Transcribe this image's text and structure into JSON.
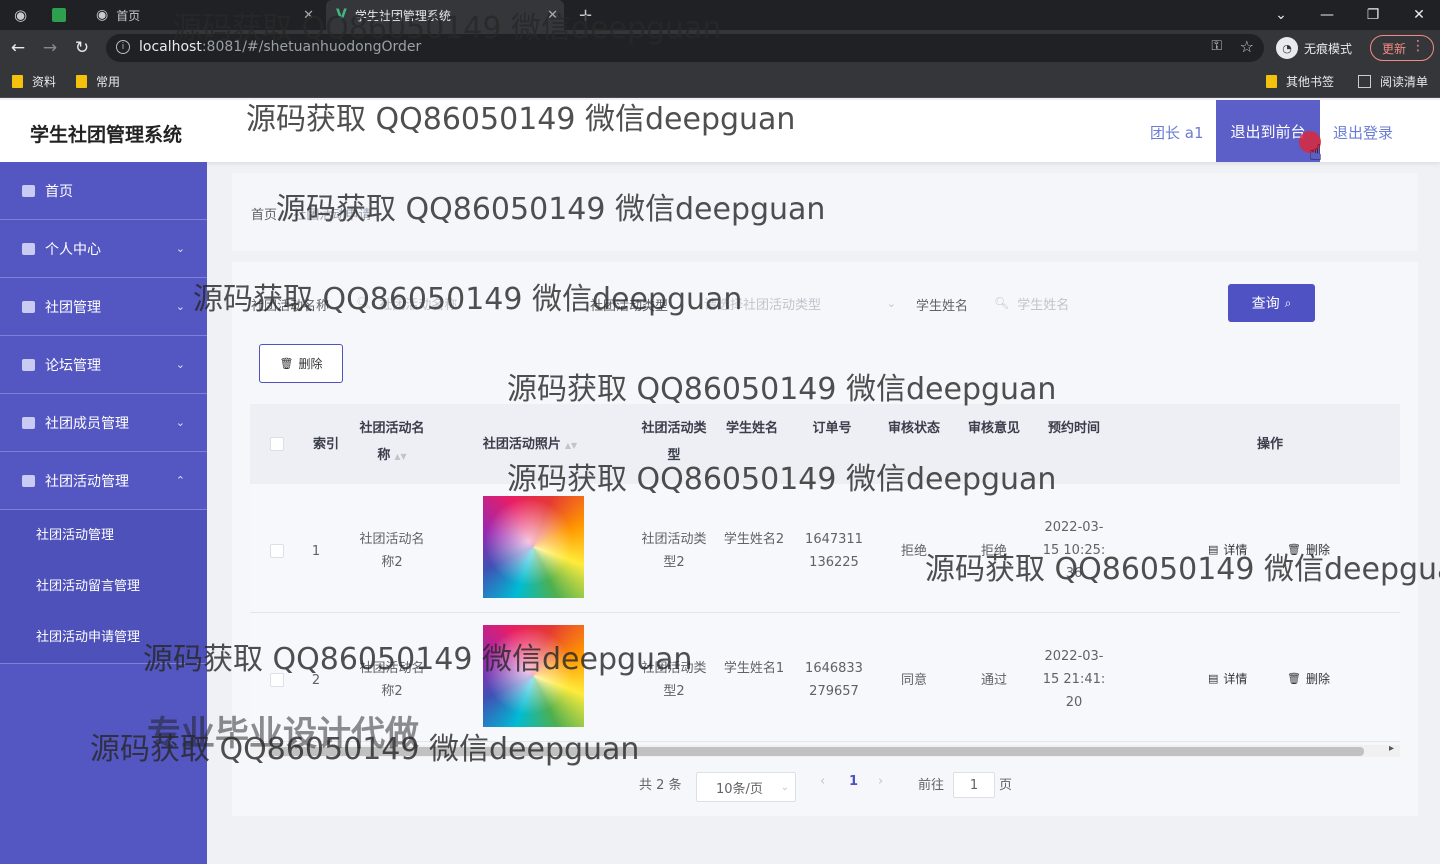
{
  "browser": {
    "tabs": [
      {
        "label": "首页",
        "active": false
      },
      {
        "label": "学生社团管理系统",
        "active": true
      }
    ],
    "new_tab": "+",
    "url_host": "localhost",
    "url_path": ":8081/#/shetuanhuodongOrder",
    "incognito_label": "无痕模式",
    "update_label": "更新",
    "bookmarks": [
      "资料",
      "常用"
    ],
    "bookmarks_right": [
      "其他书签",
      "阅读清单"
    ]
  },
  "header": {
    "title": "学生社团管理系统",
    "user": "团长 a1",
    "back_front": "退出到前台",
    "logout": "退出登录"
  },
  "sidebar": {
    "items": [
      {
        "label": "首页",
        "arrow": ""
      },
      {
        "label": "个人中心",
        "arrow": "⌄"
      },
      {
        "label": "社团管理",
        "arrow": "⌄"
      },
      {
        "label": "论坛管理",
        "arrow": "⌄"
      },
      {
        "label": "社团成员管理",
        "arrow": "⌄"
      },
      {
        "label": "社团活动管理",
        "arrow": "⌃"
      }
    ],
    "subitems": [
      "社团活动管理",
      "社团活动留言管理",
      "社团活动申请管理"
    ]
  },
  "breadcrumb": {
    "home": "首页",
    "sep": "/",
    "current": "社团活动申请"
  },
  "search": {
    "name_label": "社团活动名称",
    "name_placeholder": "社团活动名称",
    "type_label": "社团活动类型",
    "type_placeholder": "请选择社团活动类型",
    "student_label": "学生姓名",
    "student_placeholder": "学生姓名",
    "query_button": "查询"
  },
  "actions": {
    "delete": "删除"
  },
  "table": {
    "columns": {
      "index": "索引",
      "name": "社团活动名称",
      "photo": "社团活动照片",
      "type": "社团活动类型",
      "student": "学生姓名",
      "order": "订单号",
      "status": "审核状态",
      "opinion": "审核意见",
      "time": "预约时间",
      "ops": "操作"
    },
    "rows": [
      {
        "index": "1",
        "name": "社团活动名称2",
        "type": "社团活动类型2",
        "student": "学生姓名2",
        "order": "1647311136225",
        "status": "拒绝",
        "opinion": "拒绝",
        "time": "2022-03-15 10:25:36",
        "detail": "详情",
        "delete": "删除"
      },
      {
        "index": "2",
        "name": "社团活动名称2",
        "type": "社团活动类型2",
        "student": "学生姓名1",
        "order": "1646833279657",
        "status": "同意",
        "opinion": "通过",
        "time": "2022-03-15 21:41:20",
        "detail": "详情",
        "delete": "删除"
      }
    ]
  },
  "pagination": {
    "total": "共 2 条",
    "page_size": "10条/页",
    "current_page": "1",
    "goto_prefix": "前往",
    "goto_value": "1",
    "goto_suffix": "页"
  },
  "watermark": {
    "text": "源码获取 QQ86050149 微信deepguan",
    "big": "专业毕业设计代做"
  }
}
